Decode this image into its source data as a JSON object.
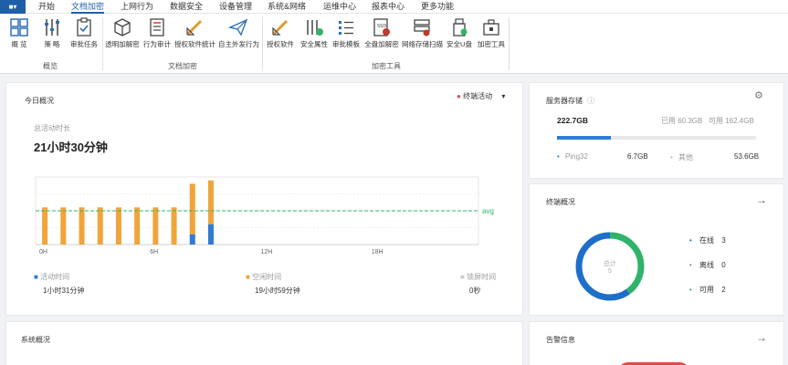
{
  "menubar": {
    "app_button": "■▾",
    "items": [
      "开始",
      "文档加密",
      "上网行为",
      "数据安全",
      "设备管理",
      "系统&网络",
      "运维中心",
      "报表中心",
      "更多功能"
    ]
  },
  "ribbon": {
    "overview_buttons": [
      "概 览",
      "策 略",
      "审批任务"
    ],
    "doc_buttons": [
      "透明加解密",
      "行为审计",
      "授权软件统计",
      "自主外发行为"
    ],
    "tool_buttons": [
      "授权软件",
      "安全属性",
      "审批模板",
      "全盘加解密",
      "网络存储扫描",
      "安全U盘",
      "加密工具"
    ],
    "groups": [
      "概览",
      "文档加密",
      "加密工具"
    ]
  },
  "today": {
    "title": "今日概况",
    "dropdown": "终端活动",
    "total_label": "总活动时长",
    "total_value": "21小时30分钟",
    "avg_label": "avg",
    "x_ticks": [
      "0H",
      "6H",
      "12H",
      "18H"
    ],
    "legend": [
      {
        "label": "活动时间",
        "value": "1小时31分钟",
        "color": "#2f7bd6"
      },
      {
        "label": "空闲时间",
        "value": "19小时59分钟",
        "color": "#f0a43a"
      },
      {
        "label": "锁屏时间",
        "value": "0秒",
        "color": "#cccccc"
      }
    ]
  },
  "chart_data": {
    "type": "bar",
    "x": [
      0,
      1,
      2,
      3,
      4,
      5,
      6,
      7,
      8,
      9
    ],
    "series": [
      {
        "name": "活动时间",
        "values": [
          0,
          0,
          0,
          0,
          0,
          0,
          0,
          0,
          0.15,
          0.3
        ]
      },
      {
        "name": "空闲时间",
        "values": [
          0.55,
          0.55,
          0.55,
          0.55,
          0.55,
          0.55,
          0.55,
          0.55,
          0.75,
          0.65
        ]
      }
    ],
    "avg": 0.5,
    "xlim": [
      0,
      24
    ],
    "ylim": [
      0,
      1
    ],
    "x_ticks": [
      "0H",
      "6H",
      "12H",
      "18H"
    ]
  },
  "storage": {
    "title": "服务器存储",
    "total": "222.7GB",
    "used": "已用 60.3GB",
    "free": "可用 162.4GB",
    "used_fraction": 0.27,
    "items": [
      {
        "name": "Ping32",
        "value": "6.7GB",
        "color": "#2f7bd6"
      },
      {
        "name": "其他",
        "value": "53.6GB",
        "color": "#bbbbbb"
      }
    ]
  },
  "terminal": {
    "title": "终端概况",
    "center_label": "总计",
    "center_value": "5",
    "legend": [
      {
        "label": "在线",
        "value": "3",
        "color": "#1e6fc9"
      },
      {
        "label": "离线",
        "value": "0",
        "color": "#888888"
      },
      {
        "label": "可用",
        "value": "2",
        "color": "#2fb36a"
      }
    ],
    "donut": {
      "online_fraction": 0.6,
      "available_fraction": 0.4
    }
  },
  "system": {
    "title": "系统概况"
  },
  "alerts": {
    "title": "告警信息"
  }
}
